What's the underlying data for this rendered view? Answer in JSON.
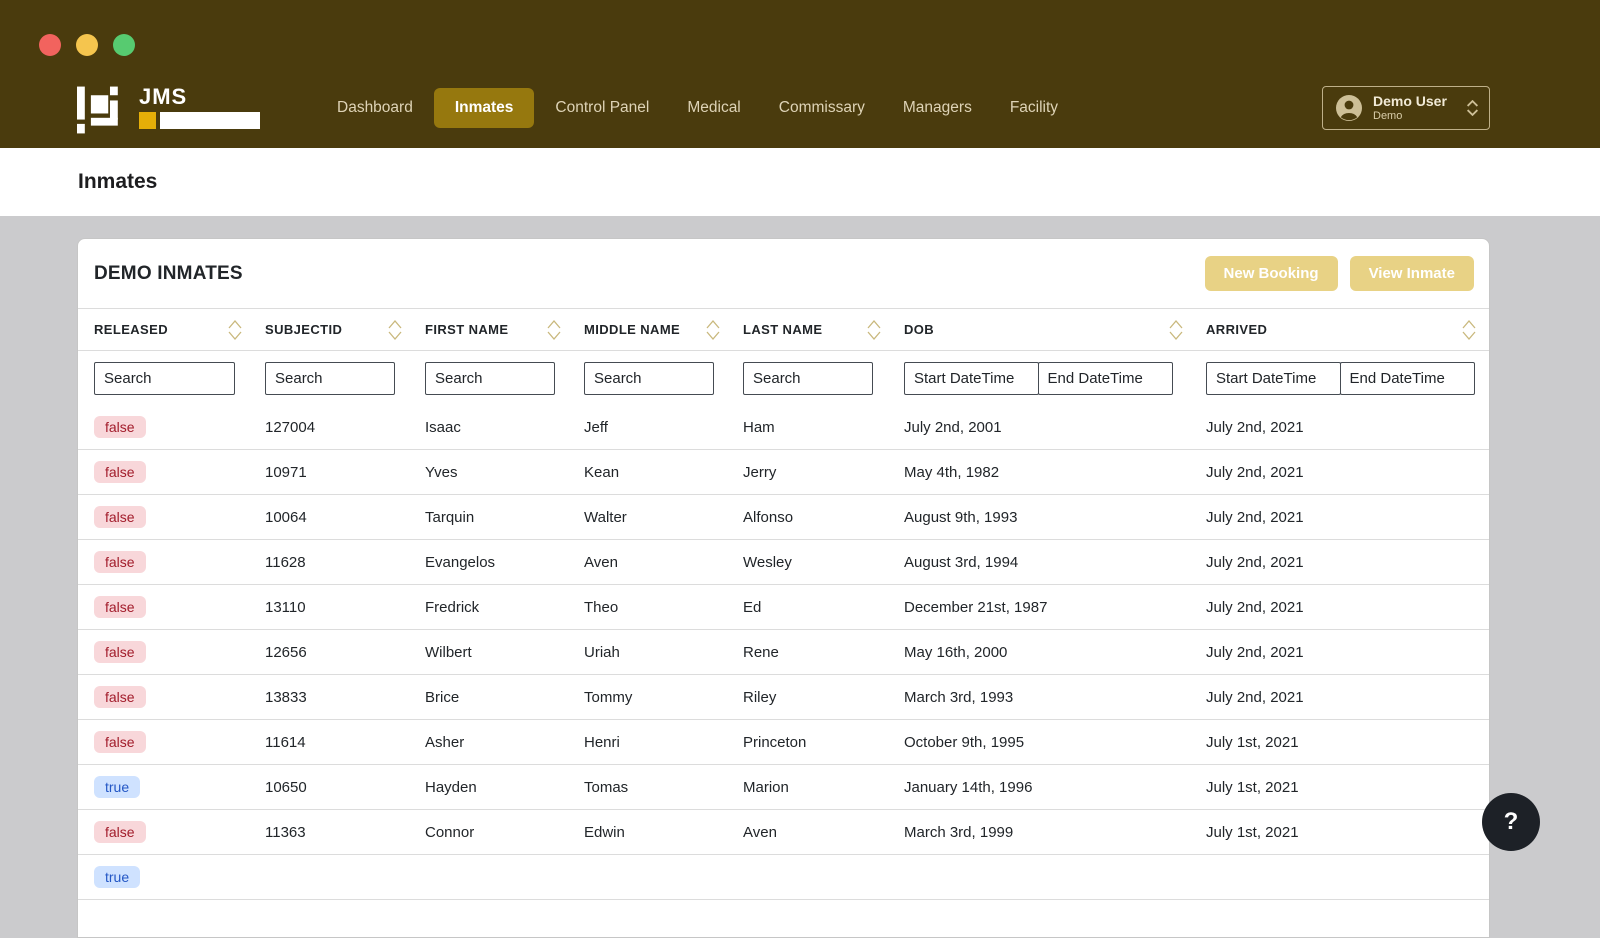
{
  "colors": {
    "header_bg": "#4a3b0d",
    "active_tab": "#96780e",
    "accent_button": "#e8d285",
    "badge_false_bg": "#f8d7da",
    "badge_false_text": "#a21c2b",
    "badge_true_bg": "#cfe2ff",
    "badge_true_text": "#2457c5",
    "traffic_lights": [
      "#f2635e",
      "#f5c54e",
      "#57cb70"
    ]
  },
  "header": {
    "logo_text": "JMS",
    "nav": [
      {
        "label": "Dashboard",
        "active": false
      },
      {
        "label": "Inmates",
        "active": true
      },
      {
        "label": "Control Panel",
        "active": false
      },
      {
        "label": "Medical",
        "active": false
      },
      {
        "label": "Commissary",
        "active": false
      },
      {
        "label": "Managers",
        "active": false
      },
      {
        "label": "Facility",
        "active": false
      }
    ],
    "user": {
      "name": "Demo User",
      "role": "Demo"
    }
  },
  "page": {
    "title": "Inmates"
  },
  "panel": {
    "title": "DEMO INMATES",
    "actions": {
      "new_booking": "New Booking",
      "view_inmate": "View Inmate"
    },
    "search_placeholder": "Search",
    "start_placeholder": "Start DateTime",
    "end_placeholder": "End DateTime",
    "columns": [
      {
        "label": "RELEASED",
        "filter": "search"
      },
      {
        "label": "SUBJECTID",
        "filter": "search"
      },
      {
        "label": "FIRST NAME",
        "filter": "search"
      },
      {
        "label": "MIDDLE NAME",
        "filter": "search"
      },
      {
        "label": "LAST NAME",
        "filter": "search"
      },
      {
        "label": "DOB",
        "filter": "daterange"
      },
      {
        "label": "ARRIVED",
        "filter": "daterange"
      }
    ],
    "rows": [
      {
        "released": "false",
        "subjectid": "127004",
        "first": "Isaac",
        "middle": "Jeff",
        "last": "Ham",
        "dob": "July 2nd, 2001",
        "arrived": "July 2nd, 2021"
      },
      {
        "released": "false",
        "subjectid": "10971",
        "first": "Yves",
        "middle": "Kean",
        "last": "Jerry",
        "dob": "May 4th, 1982",
        "arrived": "July 2nd, 2021"
      },
      {
        "released": "false",
        "subjectid": "10064",
        "first": "Tarquin",
        "middle": "Walter",
        "last": "Alfonso",
        "dob": "August 9th, 1993",
        "arrived": "July 2nd, 2021"
      },
      {
        "released": "false",
        "subjectid": "11628",
        "first": "Evangelos",
        "middle": "Aven",
        "last": "Wesley",
        "dob": "August 3rd, 1994",
        "arrived": "July 2nd, 2021"
      },
      {
        "released": "false",
        "subjectid": "13110",
        "first": "Fredrick",
        "middle": "Theo",
        "last": "Ed",
        "dob": "December 21st, 1987",
        "arrived": "July 2nd, 2021"
      },
      {
        "released": "false",
        "subjectid": "12656",
        "first": "Wilbert",
        "middle": "Uriah",
        "last": "Rene",
        "dob": "May 16th, 2000",
        "arrived": "July 2nd, 2021"
      },
      {
        "released": "false",
        "subjectid": "13833",
        "first": "Brice",
        "middle": "Tommy",
        "last": "Riley",
        "dob": "March 3rd, 1993",
        "arrived": "July 2nd, 2021"
      },
      {
        "released": "false",
        "subjectid": "11614",
        "first": "Asher",
        "middle": "Henri",
        "last": "Princeton",
        "dob": "October 9th, 1995",
        "arrived": "July 1st, 2021"
      },
      {
        "released": "true",
        "subjectid": "10650",
        "first": "Hayden",
        "middle": "Tomas",
        "last": "Marion",
        "dob": "January 14th, 1996",
        "arrived": "July 1st, 2021"
      },
      {
        "released": "false",
        "subjectid": "11363",
        "first": "Connor",
        "middle": "Edwin",
        "last": "Aven",
        "dob": "March 3rd, 1999",
        "arrived": "July 1st, 2021"
      },
      {
        "released": "true",
        "subjectid": "",
        "first": "",
        "middle": "",
        "last": "",
        "dob": "",
        "arrived": ""
      }
    ]
  },
  "help": {
    "label": "?"
  }
}
